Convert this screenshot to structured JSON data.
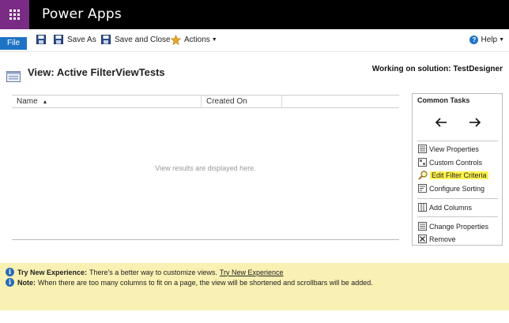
{
  "header": {
    "app_name": "Power Apps"
  },
  "toolbar": {
    "file": "File",
    "save_as": "Save As",
    "save_and_close": "Save and Close",
    "actions": "Actions",
    "help": "Help"
  },
  "page": {
    "title": "View: Active FilterViewTests",
    "solution": "Working on solution: TestDesigner"
  },
  "grid": {
    "columns": [
      "Name",
      "Created On"
    ],
    "empty_message": "View results are displayed here."
  },
  "common_tasks": {
    "title": "Common Tasks",
    "items": [
      "View Properties",
      "Custom Controls",
      "Edit Filter Criteria",
      "Configure Sorting",
      "Add Columns",
      "Change Properties",
      "Remove"
    ]
  },
  "footer": {
    "try_label": "Try New Experience:",
    "try_text": "There's a better way to customize views.",
    "try_link": "Try New Experience",
    "note_label": "Note:",
    "note_text": "When there are too many columns to fit on a page, the view will be shortened and scrollbars will be added."
  },
  "colors": {
    "waffle_bg": "#7a2b85",
    "topbar_bg": "#000000",
    "file_bg": "#1e73c7",
    "highlight": "#fff34d",
    "footer_bg": "#f9f0b3"
  }
}
